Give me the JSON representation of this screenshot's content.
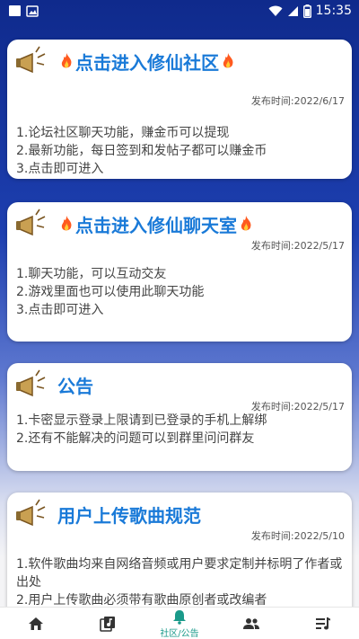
{
  "status": {
    "time": "15:35",
    "icons": [
      "notification-square-icon",
      "image-notification-icon",
      "wifi-icon",
      "signal-icon",
      "battery-icon"
    ]
  },
  "cards": [
    {
      "title": "点击进入修仙社区",
      "date": "发布时间:2022/6/17",
      "lines": [
        "1.论坛社区聊天功能，赚金币可以提现",
        "2.最新功能，每日签到和发帖子都可以赚金币",
        "3.点击即可进入"
      ]
    },
    {
      "title": "点击进入修仙聊天室",
      "date": "发布时间:2022/5/17",
      "lines": [
        "1.聊天功能，可以互动交友",
        "2.游戏里面也可以使用此聊天功能",
        "3.点击即可进入"
      ]
    },
    {
      "title": "公告",
      "date": "发布时间:2022/5/17",
      "lines": [
        "1.卡密显示登录上限请到已登录的手机上解绑",
        "2.还有不能解决的问题可以到群里问问群友"
      ]
    },
    {
      "title": "用户上传歌曲规范",
      "date": "发布时间:2022/5/10",
      "lines": [
        "1.软件歌曲均来自网络音频或用户要求定制并标明了作者或",
        "出处",
        "2.用户上传歌曲必须带有歌曲原创者或改编者"
      ]
    }
  ],
  "nav": {
    "items": [
      {
        "icon": "home-icon",
        "label": ""
      },
      {
        "icon": "library-music-icon",
        "label": ""
      },
      {
        "icon": "bell-icon",
        "label": "社区/公告"
      },
      {
        "icon": "people-icon",
        "label": ""
      },
      {
        "icon": "playlist-icon",
        "label": ""
      }
    ]
  },
  "colors": {
    "accent": "#1a7ad8",
    "nav_active": "#1a9a8a",
    "header_bg": "#1d3fb0"
  }
}
